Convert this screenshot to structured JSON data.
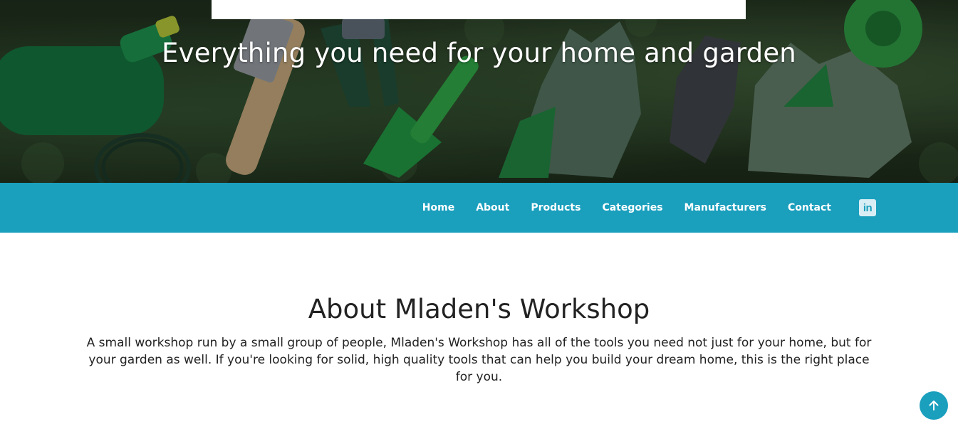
{
  "hero": {
    "title": "Everything you need for your home and garden"
  },
  "nav": {
    "items": [
      {
        "label": "Home"
      },
      {
        "label": "About"
      },
      {
        "label": "Products"
      },
      {
        "label": "Categories"
      },
      {
        "label": "Manufacturers"
      },
      {
        "label": "Contact"
      }
    ],
    "social_icon": "linkedin-icon",
    "social_glyph": "in"
  },
  "about": {
    "title": "About Mladen's Workshop",
    "text": "A small workshop run by a small group of people, Mladen's Workshop has all of the tools you need not just for your home, but for your garden as well. If you're looking for solid, high quality tools that can help you build your dream home, this is the right place for you."
  },
  "back_to_top": {
    "icon": "arrow-up-icon"
  },
  "colors": {
    "accent": "#1a9fbd",
    "hero_bg": "#263923"
  }
}
